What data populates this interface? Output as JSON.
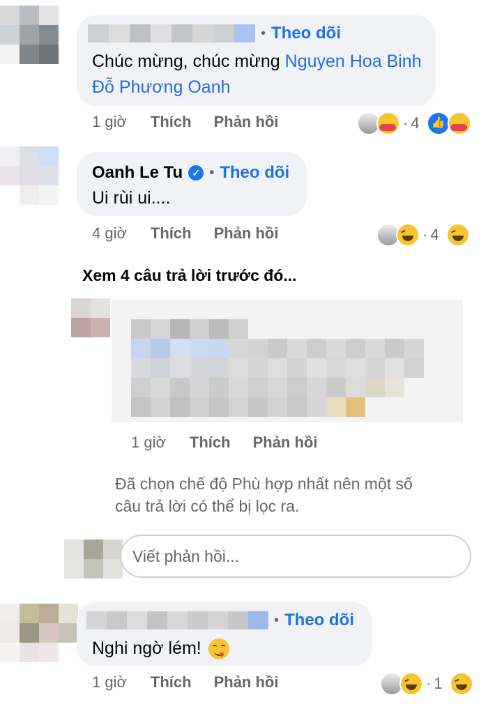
{
  "comments": [
    {
      "follow_label": "Theo dõi",
      "dot": "•",
      "text_plain": "Chúc mừng, chúc mừng ",
      "text_link": "Nguyen Hoa Binh Đỗ Phương Oanh",
      "time": "1 giờ",
      "like_label": "Thích",
      "reply_label": "Phản hồi",
      "reaction_count_1": "4",
      "reaction_count_2": "",
      "reaction_icons": [
        "user-avatar-icon",
        "care-icon",
        "like-icon",
        "care-icon"
      ]
    },
    {
      "author": "Oanh Le Tu",
      "verified": true,
      "follow_label": "Theo dõi",
      "dot": "•",
      "text": "Ui rùi ui....",
      "time": "4 giờ",
      "like_label": "Thích",
      "reply_label": "Phản hồi",
      "reaction_count": "4",
      "reaction_icons": [
        "user-avatar-icon",
        "haha-icon",
        "haha-icon"
      ]
    }
  ],
  "view_previous": "Xem 4 câu trả lời trước đó...",
  "reply": {
    "time": "1 giờ",
    "like_label": "Thích",
    "reply_label": "Phản hồi"
  },
  "filter_notice": "Đã chọn chế độ Phù hợp nhất nên một số câu trả lời có thể bị lọc ra.",
  "reply_input": {
    "placeholder": "Viết phản hồi..."
  },
  "last_comment": {
    "follow_label": "Theo dõi",
    "dot": "•",
    "text": "Nghi ngờ lém!",
    "emoji": "yum-emoji",
    "time": "1 giờ",
    "like_label": "Thích",
    "reply_label": "Phản hồi",
    "reaction_count": "1",
    "reaction_icons": [
      "user-avatar-icon",
      "haha-icon",
      "haha-icon"
    ]
  },
  "colors": {
    "link": "#216fdb",
    "follow": "#1b74e4",
    "bubble": "#f0f2f5",
    "meta": "#65676b"
  }
}
